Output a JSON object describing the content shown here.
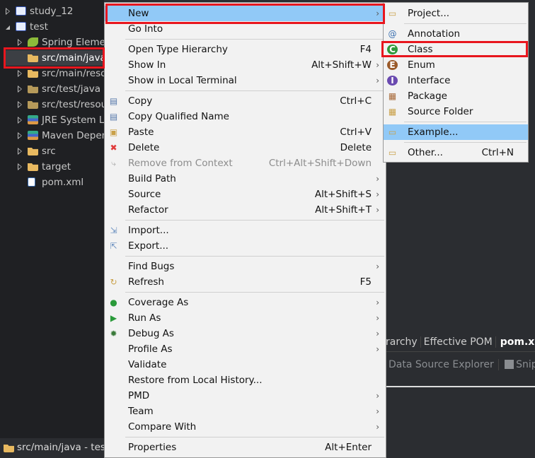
{
  "tree": {
    "items": [
      {
        "label": "study_12",
        "level": 0,
        "expand": "collapsed",
        "icon": "maven-project-warning-icon"
      },
      {
        "label": "test",
        "level": 0,
        "expand": "expanded",
        "icon": "maven-project-icon"
      },
      {
        "label": "Spring Elements",
        "level": 1,
        "expand": "collapsed",
        "icon": "spring-leaf-icon"
      },
      {
        "label": "src/main/java",
        "level": 1,
        "expand": "none",
        "icon": "source-folder-icon",
        "selected": true
      },
      {
        "label": "src/main/resources",
        "level": 1,
        "expand": "collapsed",
        "icon": "source-folder-icon"
      },
      {
        "label": "src/test/java",
        "level": 1,
        "expand": "collapsed",
        "icon": "test-source-folder-icon"
      },
      {
        "label": "src/test/resources",
        "level": 1,
        "expand": "collapsed",
        "icon": "test-source-folder-icon"
      },
      {
        "label": "JRE System Library",
        "level": 1,
        "expand": "collapsed",
        "icon": "library-icon"
      },
      {
        "label": "Maven Dependencies",
        "level": 1,
        "expand": "collapsed",
        "icon": "library-icon"
      },
      {
        "label": "src",
        "level": 1,
        "expand": "collapsed",
        "icon": "folder-icon"
      },
      {
        "label": "target",
        "level": 1,
        "expand": "collapsed",
        "icon": "folder-icon"
      },
      {
        "label": "pom.xml",
        "level": 1,
        "expand": "none",
        "icon": "maven-xml-icon"
      }
    ]
  },
  "status": {
    "label": "src/main/java - test"
  },
  "editor": {
    "tabs": [
      "Hierarchy",
      "Effective POM",
      "pom.xml"
    ],
    "views": [
      "Data Source Explorer",
      "Snippets"
    ]
  },
  "context_menu": {
    "groups": [
      [
        {
          "label": "New",
          "submenu": true,
          "highlighted": true
        },
        {
          "label": "Go Into"
        }
      ],
      [
        {
          "label": "Open Type Hierarchy",
          "shortcut": "F4"
        },
        {
          "label": "Show In",
          "shortcut": "Alt+Shift+W",
          "submenu": true
        },
        {
          "label": "Show in Local Terminal",
          "submenu": true
        }
      ],
      [
        {
          "label": "Copy",
          "shortcut": "Ctrl+C",
          "icon": "copy-icon"
        },
        {
          "label": "Copy Qualified Name",
          "icon": "copy-qualified-icon"
        },
        {
          "label": "Paste",
          "shortcut": "Ctrl+V",
          "icon": "paste-icon"
        },
        {
          "label": "Delete",
          "shortcut": "Delete",
          "icon": "delete-icon"
        },
        {
          "label": "Remove from Context",
          "shortcut": "Ctrl+Alt+Shift+Down",
          "disabled": true,
          "icon": "remove-context-icon"
        },
        {
          "label": "Build Path",
          "submenu": true
        },
        {
          "label": "Source",
          "shortcut": "Alt+Shift+S",
          "submenu": true
        },
        {
          "label": "Refactor",
          "shortcut": "Alt+Shift+T",
          "submenu": true
        }
      ],
      [
        {
          "label": "Import...",
          "icon": "import-icon"
        },
        {
          "label": "Export...",
          "icon": "export-icon"
        }
      ],
      [
        {
          "label": "Find Bugs",
          "submenu": true
        },
        {
          "label": "Refresh",
          "shortcut": "F5",
          "icon": "refresh-icon"
        }
      ],
      [
        {
          "label": "Coverage As",
          "submenu": true,
          "icon": "coverage-icon"
        },
        {
          "label": "Run As",
          "submenu": true,
          "icon": "run-icon"
        },
        {
          "label": "Debug As",
          "submenu": true,
          "icon": "debug-bug-icon"
        },
        {
          "label": "Profile As",
          "submenu": true
        },
        {
          "label": "Validate"
        },
        {
          "label": "Restore from Local History..."
        },
        {
          "label": "PMD",
          "submenu": true
        },
        {
          "label": "Team",
          "submenu": true
        },
        {
          "label": "Compare With",
          "submenu": true
        }
      ],
      [
        {
          "label": "Properties",
          "shortcut": "Alt+Enter"
        }
      ]
    ]
  },
  "new_submenu": {
    "groups": [
      [
        {
          "label": "Project...",
          "icon": "new-project-icon"
        }
      ],
      [
        {
          "label": "Annotation",
          "icon": "new-annotation-icon"
        },
        {
          "label": "Class",
          "icon": "new-class-icon",
          "outlined": true
        },
        {
          "label": "Enum",
          "icon": "new-enum-icon"
        },
        {
          "label": "Interface",
          "icon": "new-interface-icon"
        },
        {
          "label": "Package",
          "icon": "new-package-icon"
        },
        {
          "label": "Source Folder",
          "icon": "new-source-folder-icon"
        }
      ],
      [
        {
          "label": "Example...",
          "icon": "new-example-icon",
          "highlighted": true
        }
      ],
      [
        {
          "label": "Other...",
          "shortcut": "Ctrl+N",
          "icon": "new-wizard-icon"
        }
      ]
    ]
  },
  "colors": {
    "highlight": "#91c9f7",
    "annotation_box": "#e8161e",
    "menu_bg": "#f2f2f2",
    "tree_bg": "#1f2023"
  }
}
